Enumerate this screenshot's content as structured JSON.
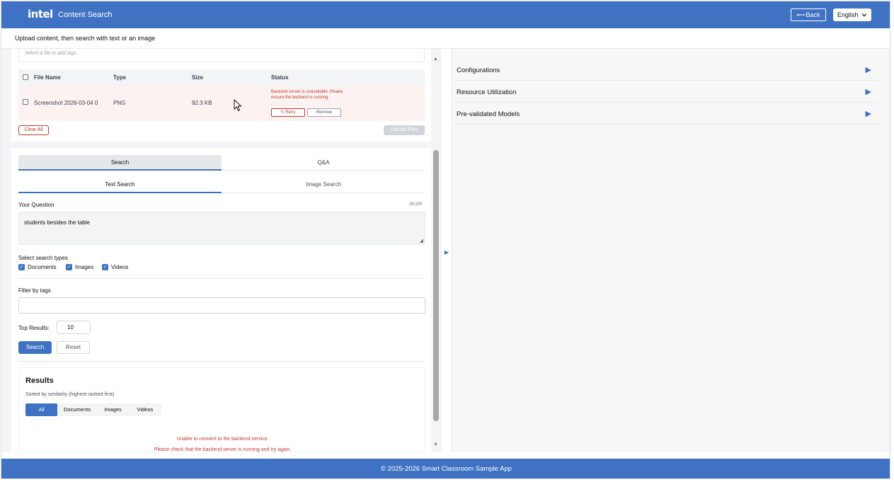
{
  "header": {
    "logo": "intel",
    "title": "Content Search",
    "back_label": "⟵Back",
    "language": "English"
  },
  "subheader": {
    "text": "Upload content, then search with text or an image"
  },
  "upload": {
    "tags_placeholder": "Select a file to add tags.",
    "columns": [
      "File Name",
      "Type",
      "Size",
      "Status"
    ],
    "file": {
      "name": "Screenshot 2026-03-04 0",
      "type": "PNG",
      "size": "92.3 KB",
      "status_error": "Backend server is unavailable. Please ensure the backend is running.",
      "retry_label": "↻ Retry",
      "remove_label": "Remove"
    },
    "clear_label": "Clear All",
    "upload_label": "Upload Files"
  },
  "search": {
    "tabs": [
      "Search",
      "Q&A"
    ],
    "subtabs": [
      "Text Search",
      "Image Search"
    ],
    "question_label": "Your Question",
    "counter": "26/100",
    "question_value": "students besides the table",
    "types_label": "Select search types",
    "types": [
      "Documents",
      "Images",
      "Videos"
    ],
    "filter_label": "Filter by tags",
    "top_label": "Top Results:",
    "top_value": "10",
    "search_label": "Search",
    "reset_label": "Reset"
  },
  "results": {
    "title": "Results",
    "subtitle": "Sorted by similarity (highest-ranked first)",
    "filters": [
      "All",
      "Documents",
      "Images",
      "Videos"
    ],
    "error_title": "Unable to connect to the backend service.",
    "error_detail": "Please check that the backend server is running and try again."
  },
  "sidebar": {
    "items": [
      "Configurations",
      "Resource Utilization",
      "Pre-validated Models"
    ]
  },
  "footer": {
    "text": "© 2025-2026 Smart Classroom Sample App"
  },
  "colors": {
    "brand": "#3f72c2",
    "error": "#c0392b"
  }
}
